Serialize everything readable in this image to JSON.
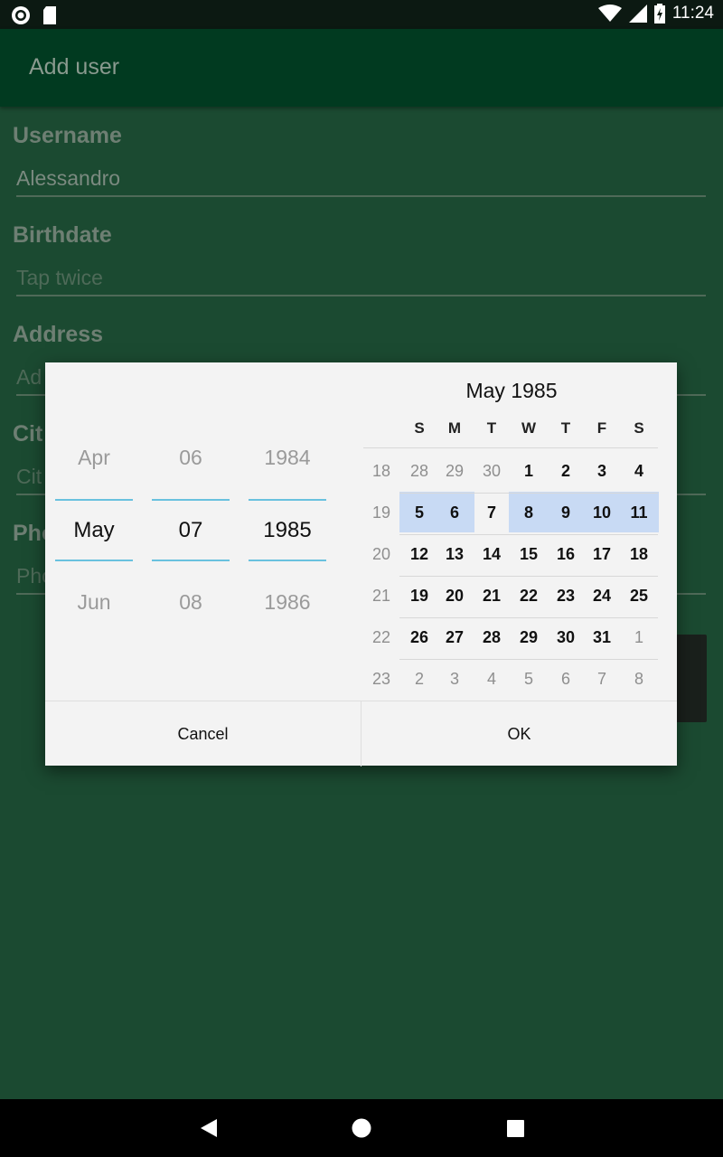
{
  "status_bar": {
    "time": "11:24"
  },
  "app_bar": {
    "title": "Add user"
  },
  "form": {
    "username": {
      "label": "Username",
      "value": "Alessandro"
    },
    "birthdate": {
      "label": "Birthdate",
      "placeholder": "Tap twice"
    },
    "address": {
      "label": "Address",
      "placeholder": "Ad"
    },
    "city": {
      "label": "Cit",
      "placeholder": "Cit"
    },
    "phone": {
      "label": "Pho",
      "placeholder": "Pho"
    }
  },
  "dialog": {
    "spinners": {
      "month": {
        "prev": "Apr",
        "current": "May",
        "next": "Jun"
      },
      "day": {
        "prev": "06",
        "current": "07",
        "next": "08"
      },
      "year": {
        "prev": "1984",
        "current": "1985",
        "next": "1986"
      }
    },
    "calendar": {
      "title": "May 1985",
      "weekdays": [
        "S",
        "M",
        "T",
        "W",
        "T",
        "F",
        "S"
      ],
      "weeks": [
        {
          "num": "18",
          "days": [
            "28",
            "29",
            "30",
            "1",
            "2",
            "3",
            "4"
          ],
          "muted": [
            true,
            true,
            true,
            false,
            false,
            false,
            false
          ]
        },
        {
          "num": "19",
          "days": [
            "5",
            "6",
            "7",
            "8",
            "9",
            "10",
            "11"
          ],
          "muted": [
            false,
            false,
            false,
            false,
            false,
            false,
            false
          ]
        },
        {
          "num": "20",
          "days": [
            "12",
            "13",
            "14",
            "15",
            "16",
            "17",
            "18"
          ],
          "muted": [
            false,
            false,
            false,
            false,
            false,
            false,
            false
          ]
        },
        {
          "num": "21",
          "days": [
            "19",
            "20",
            "21",
            "22",
            "23",
            "24",
            "25"
          ],
          "muted": [
            false,
            false,
            false,
            false,
            false,
            false,
            false
          ]
        },
        {
          "num": "22",
          "days": [
            "26",
            "27",
            "28",
            "29",
            "30",
            "31",
            "1"
          ],
          "muted": [
            false,
            false,
            false,
            false,
            false,
            false,
            true
          ]
        },
        {
          "num": "23",
          "days": [
            "2",
            "3",
            "4",
            "5",
            "6",
            "7",
            "8"
          ],
          "muted": [
            true,
            true,
            true,
            true,
            true,
            true,
            true
          ]
        }
      ],
      "selected_day": "7",
      "highlight_color": "#c8daf4"
    },
    "buttons": {
      "cancel": "Cancel",
      "ok": "OK"
    }
  },
  "colors": {
    "background": "#1b4a31",
    "app_bar": "#013a20",
    "accent_line": "#69c1df"
  }
}
